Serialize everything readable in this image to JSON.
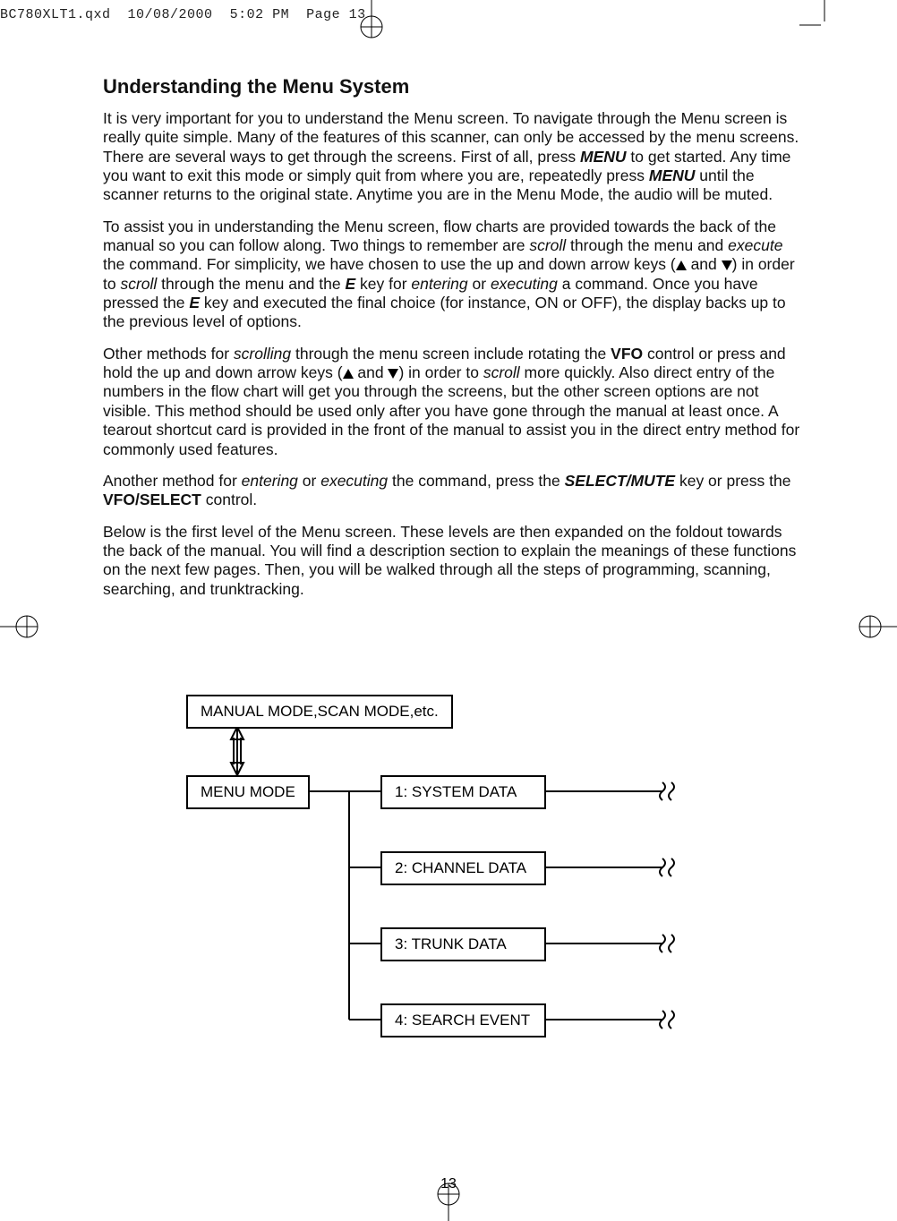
{
  "header": {
    "filename": "BC780XLT1.qxd",
    "date": "10/08/2000",
    "time": "5:02 PM",
    "page_label": "Page 13"
  },
  "title": "Understanding the Menu System",
  "p1a": "It is very important for you to understand the Menu screen. To navigate through the Menu screen is really quite simple. Many of the features of this scanner, can only be accessed by the menu screens. There are several ways to get through the screens. First of all, press ",
  "p1_menu": "MENU",
  "p1b": " to get started. Any time you want to exit this mode or simply quit from where you are, repeatedly press ",
  "p1c": " until the scanner returns to the original state. Anytime you are in the Menu Mode, the audio will be muted.",
  "p2a": "To assist you in understanding the Menu screen, flow charts are provided towards the back of the manual so you can follow along. Two things to remember are ",
  "p2_scroll": "scroll",
  "p2b": " through the menu and ",
  "p2_execute": "execute",
  "p2c": " the command. For simplicity, we have chosen to use the up and down arrow keys (",
  "p2d": " and ",
  "p2e": ") in order to ",
  "p2f": " through the menu and the ",
  "p2_E": "E",
  "p2g": " key for ",
  "p2_entering": "entering",
  "p2h": " or ",
  "p2_executing": "executing",
  "p2i": " a command. Once you have pressed the ",
  "p2j": " key and executed the final choice (for instance, ON or OFF), the display backs up to the previous level of options.",
  "p3a": "Other methods for ",
  "p3_scrolling": "scrolling",
  "p3b": " through the menu screen include rotating the ",
  "p3_vfo": "VFO",
  "p3c": " control or press and hold the up and down arrow keys (",
  "p3d": " and ",
  "p3e": ") in order to ",
  "p3_scroll": "scroll",
  "p3f": " more quickly. Also direct entry of the numbers in the flow chart will get you through the screens, but the other screen options are not visible. This method should be used only after you have gone through the manual at least once. A tearout shortcut card is provided in the front of the manual to assist you in the direct entry method for commonly used features.",
  "p4a": "Another method for ",
  "p4b": " or ",
  "p4c": " the command, press the ",
  "p4_select": "SELECT/MUTE",
  "p4d": " key or press the ",
  "p4_vfosel": "VFO/SELECT",
  "p4e": " control.",
  "p5": "Below is the first level of the Menu screen. These levels are then expanded on the foldout towards the back of the manual. You will find a description section to explain the meanings of these functions on the next few pages. Then, you will be walked through all the steps of programming, scanning, searching, and trunktracking.",
  "diagram": {
    "box_top": "MANUAL MODE,SCAN MODE,etc.",
    "box_menu": "MENU MODE",
    "items": [
      "1: SYSTEM DATA",
      "2: CHANNEL DATA",
      "3: TRUNK DATA",
      "4: SEARCH EVENT"
    ]
  },
  "page_number": "13"
}
